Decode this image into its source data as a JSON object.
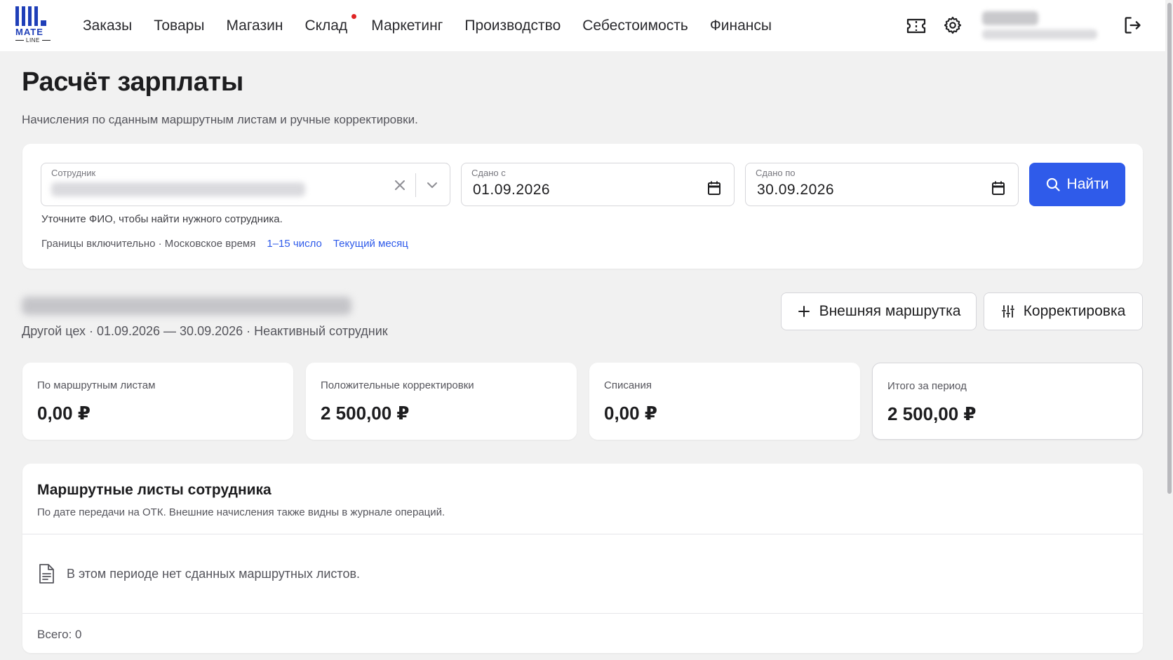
{
  "logo": {
    "word": "MATE",
    "sub": "LINE"
  },
  "nav": {
    "items": [
      {
        "label": "Заказы"
      },
      {
        "label": "Товары"
      },
      {
        "label": "Магазин"
      },
      {
        "label": "Склад",
        "badge": true
      },
      {
        "label": "Маркетинг"
      },
      {
        "label": "Производство"
      },
      {
        "label": "Себестоимость"
      },
      {
        "label": "Финансы"
      }
    ]
  },
  "user": {
    "name": "████████",
    "email": "████████████████"
  },
  "page": {
    "title": "Расчёт зарплаты",
    "subtitle": "Начисления по сданным маршрутным листам и ручные корректировки."
  },
  "filter": {
    "employee_label": "Сотрудник",
    "employee_value": "████████████████████████",
    "date_from_label": "Сдано с",
    "date_from_value": "01.09.2026",
    "date_to_label": "Сдано по",
    "date_to_value": "30.09.2026",
    "find_label": "Найти",
    "hint": "Уточните ФИО, чтобы найти нужного сотрудника.",
    "bounds_text": "Границы включительно · Московское время",
    "preset_half": "1–15 число",
    "preset_month": "Текущий месяц"
  },
  "employee": {
    "name": "████████████████████████████",
    "meta": "Другой цех · 01.09.2026 — 30.09.2026 · Неактивный сотрудник",
    "external_button": "Внешняя маршрутка",
    "adjust_button": "Корректировка"
  },
  "summary": [
    {
      "label": "По маршрутным листам",
      "value": "0,00 ₽"
    },
    {
      "label": "Положительные корректировки",
      "value": "2 500,00 ₽"
    },
    {
      "label": "Списания",
      "value": "0,00 ₽"
    },
    {
      "label": "Итого за период",
      "value": "2 500,00 ₽"
    }
  ],
  "routes": {
    "title": "Маршрутные листы сотрудника",
    "subtitle": "По дате передачи на ОТК. Внешние начисления также видны в журнале операций.",
    "empty": "В этом периоде нет сданных маршрутных листов.",
    "total": "Всего: 0"
  },
  "colors": {
    "accent": "#2f5bea",
    "brand": "#1f3fb8",
    "badge": "#e02424"
  }
}
